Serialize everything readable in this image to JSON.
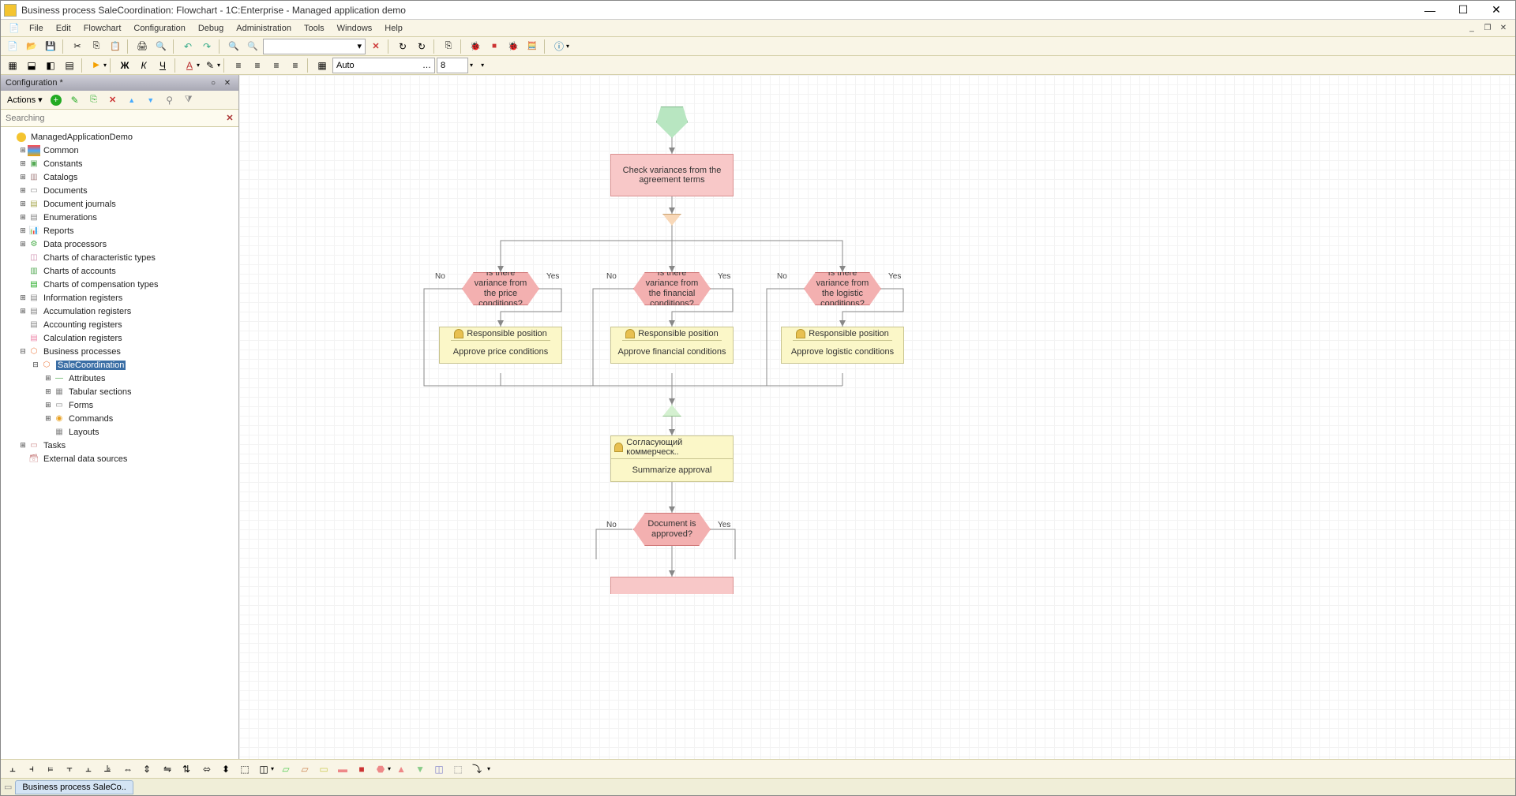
{
  "window": {
    "title": "Business process SaleCoordination: Flowchart - 1C:Enterprise - Managed application demo"
  },
  "menubar": [
    "File",
    "Edit",
    "Flowchart",
    "Configuration",
    "Debug",
    "Administration",
    "Tools",
    "Windows",
    "Help"
  ],
  "toolbar2": {
    "scale_mode": "Auto",
    "scale_value": "8"
  },
  "config_panel": {
    "title": "Configuration *",
    "actions_label": "Actions",
    "search_placeholder": "Searching"
  },
  "tree": {
    "root": "ManagedApplicationDemo",
    "items": [
      "Common",
      "Constants",
      "Catalogs",
      "Documents",
      "Document journals",
      "Enumerations",
      "Reports",
      "Data processors",
      "Charts of characteristic types",
      "Charts of accounts",
      "Charts of compensation types",
      "Information registers",
      "Accumulation registers",
      "Accounting registers",
      "Calculation registers",
      "Business processes",
      "Tasks",
      "External data sources"
    ],
    "bp_item": "SaleCoordination",
    "bp_children": [
      "Attributes",
      "Tabular sections",
      "Forms",
      "Commands",
      "Layouts"
    ]
  },
  "flowchart": {
    "check_variances": "Check variances from the agreement terms",
    "decision_price": "Is there variance from the price conditions?",
    "decision_financial": "Is there variance from the financial conditions?",
    "decision_logistic": "Is there variance from the logistic conditions?",
    "role_responsible": "Responsible position",
    "approve_price": "Approve price conditions",
    "approve_financial": "Approve financial conditions",
    "approve_logistic": "Approve logistic conditions",
    "role_commercial": "Согласующий коммерческ..",
    "summarize": "Summarize approval",
    "decision_approved": "Document is approved?",
    "label_no": "No",
    "label_yes": "Yes"
  },
  "tabbar": {
    "doc1": "Business process SaleCo.."
  }
}
